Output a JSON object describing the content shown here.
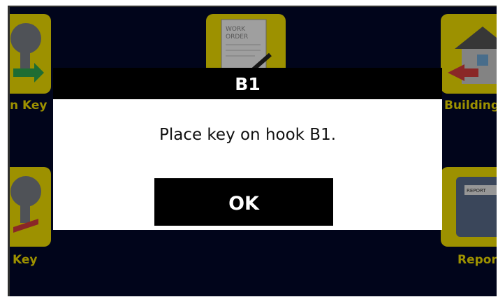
{
  "tiles": {
    "return_key_label": "n Key",
    "building_label": "Building",
    "key_label": "Key",
    "report_label": "Repor",
    "work_order_doc_line1": "WORK",
    "work_order_doc_line2": "ORDER",
    "report_doc_text": "REPORT"
  },
  "dialog": {
    "title": "B1",
    "message": "Place key on hook B1.",
    "ok_label": "OK"
  },
  "colors": {
    "tile_yellow": "#f2df00",
    "screen_bg": "#03092a",
    "dialog_bar": "#000000"
  }
}
